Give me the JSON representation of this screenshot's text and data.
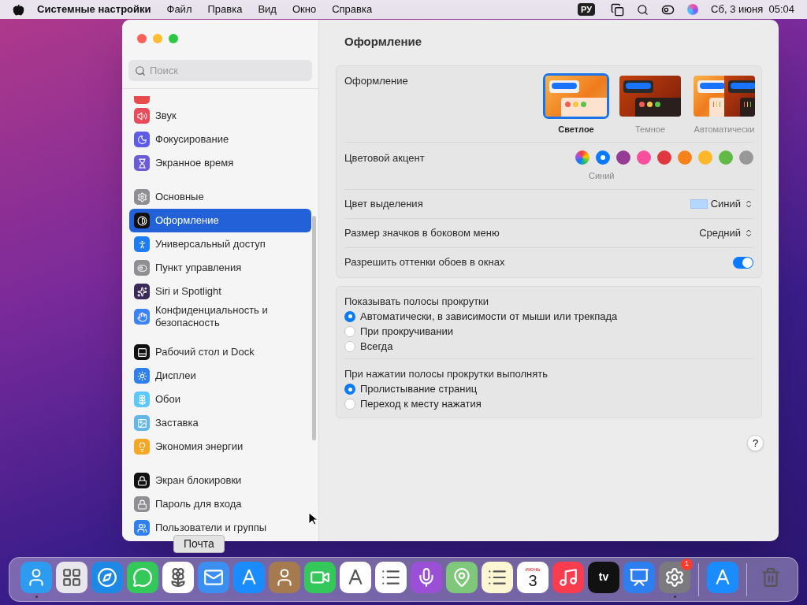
{
  "menubar": {
    "app": "Системные настройки",
    "menus": [
      "Файл",
      "Правка",
      "Вид",
      "Окно",
      "Справка"
    ],
    "input_source": "РУ",
    "datetime": "Сб, 3 июня  05:04"
  },
  "window": {
    "search": {
      "placeholder": "Поиск"
    },
    "sidebar": {
      "groups": [
        [
          {
            "label": "Звук",
            "selected": false
          },
          {
            "label": "Фокусирование",
            "selected": false
          },
          {
            "label": "Экранное время",
            "selected": false
          }
        ],
        [
          {
            "label": "Основные",
            "selected": false
          },
          {
            "label": "Оформление",
            "selected": true
          },
          {
            "label": "Универсальный доступ",
            "selected": false
          },
          {
            "label": "Пункт управления",
            "selected": false
          },
          {
            "label": "Siri и Spotlight",
            "selected": false
          },
          {
            "label": "Конфиденциальность и безопасность",
            "selected": false
          }
        ],
        [
          {
            "label": "Рабочий стол и Dock",
            "selected": false
          },
          {
            "label": "Дисплеи",
            "selected": false
          },
          {
            "label": "Обои",
            "selected": false
          },
          {
            "label": "Заставка",
            "selected": false
          },
          {
            "label": "Экономия энергии",
            "selected": false
          }
        ],
        [
          {
            "label": "Экран блокировки",
            "selected": false
          },
          {
            "label": "Пароль для входа",
            "selected": false
          },
          {
            "label": "Пользователи и группы",
            "selected": false
          }
        ]
      ]
    },
    "title": "Оформление",
    "appearance": {
      "label": "Оформление",
      "options": [
        {
          "kind": "light",
          "label": "Светлое",
          "selected": true
        },
        {
          "kind": "dark",
          "label": "Темное",
          "selected": false
        },
        {
          "kind": "auto",
          "label": "Автоматически",
          "selected": false
        }
      ]
    },
    "accent": {
      "label": "Цветовой акцент",
      "colors": [
        {
          "kind": "multicolor",
          "selected": false
        },
        {
          "kind": "solid",
          "color": "#0a7aff",
          "selected": true
        },
        {
          "kind": "solid",
          "color": "#953d96",
          "selected": false
        },
        {
          "kind": "solid",
          "color": "#f74f9e",
          "selected": false
        },
        {
          "kind": "solid",
          "color": "#e0383e",
          "selected": false
        },
        {
          "kind": "solid",
          "color": "#f7821b",
          "selected": false
        },
        {
          "kind": "solid",
          "color": "#fcb827",
          "selected": false
        },
        {
          "kind": "solid",
          "color": "#62ba46",
          "selected": false
        },
        {
          "kind": "solid",
          "color": "#989898",
          "selected": false
        }
      ],
      "caption": "Синий"
    },
    "highlight": {
      "label": "Цвет выделения",
      "value": "Синий"
    },
    "icon_size": {
      "label": "Размер значков в боковом меню",
      "value": "Средний"
    },
    "tinting": {
      "label": "Разрешить оттенки обоев в окнах",
      "on": true
    },
    "scrollbars": {
      "label": "Показывать полосы прокрутки",
      "options": [
        {
          "label": "Автоматически, в зависимости от мыши или трекпада",
          "selected": true
        },
        {
          "label": "При прокручивании",
          "selected": false
        },
        {
          "label": "Всегда",
          "selected": false
        }
      ]
    },
    "click": {
      "label": "При нажатии полосы прокрутки выполнять",
      "options": [
        {
          "label": "Пролистывание страниц",
          "selected": true
        },
        {
          "label": "Переход к месту нажатия",
          "selected": false
        }
      ]
    },
    "help": "?"
  },
  "tooltip": "Почта",
  "dock": [
    {
      "kind": "finder",
      "running": true
    },
    {
      "kind": "launchpad",
      "running": false
    },
    {
      "kind": "safari",
      "running": false
    },
    {
      "kind": "messages",
      "running": false
    },
    {
      "kind": "photos",
      "running": false
    },
    {
      "kind": "mail",
      "running": false
    },
    {
      "kind": "appstore",
      "running": false
    },
    {
      "kind": "contacts",
      "running": false
    },
    {
      "kind": "facetime",
      "running": false
    },
    {
      "kind": "freeform",
      "running": false
    },
    {
      "kind": "reminders",
      "running": false
    },
    {
      "kind": "podcasts",
      "running": false
    },
    {
      "kind": "maps",
      "running": false
    },
    {
      "kind": "notes",
      "running": false
    },
    {
      "kind": "calendar",
      "month": "июнь",
      "day": "3",
      "running": false
    },
    {
      "kind": "music",
      "running": false
    },
    {
      "kind": "tv",
      "text": "tv",
      "running": false
    },
    {
      "kind": "keynote",
      "running": false
    },
    {
      "kind": "settings",
      "badge": "1",
      "running": true
    },
    {
      "kind": "separator"
    },
    {
      "kind": "appstore",
      "running": false
    },
    {
      "kind": "separator"
    },
    {
      "kind": "trash",
      "running": false
    }
  ]
}
